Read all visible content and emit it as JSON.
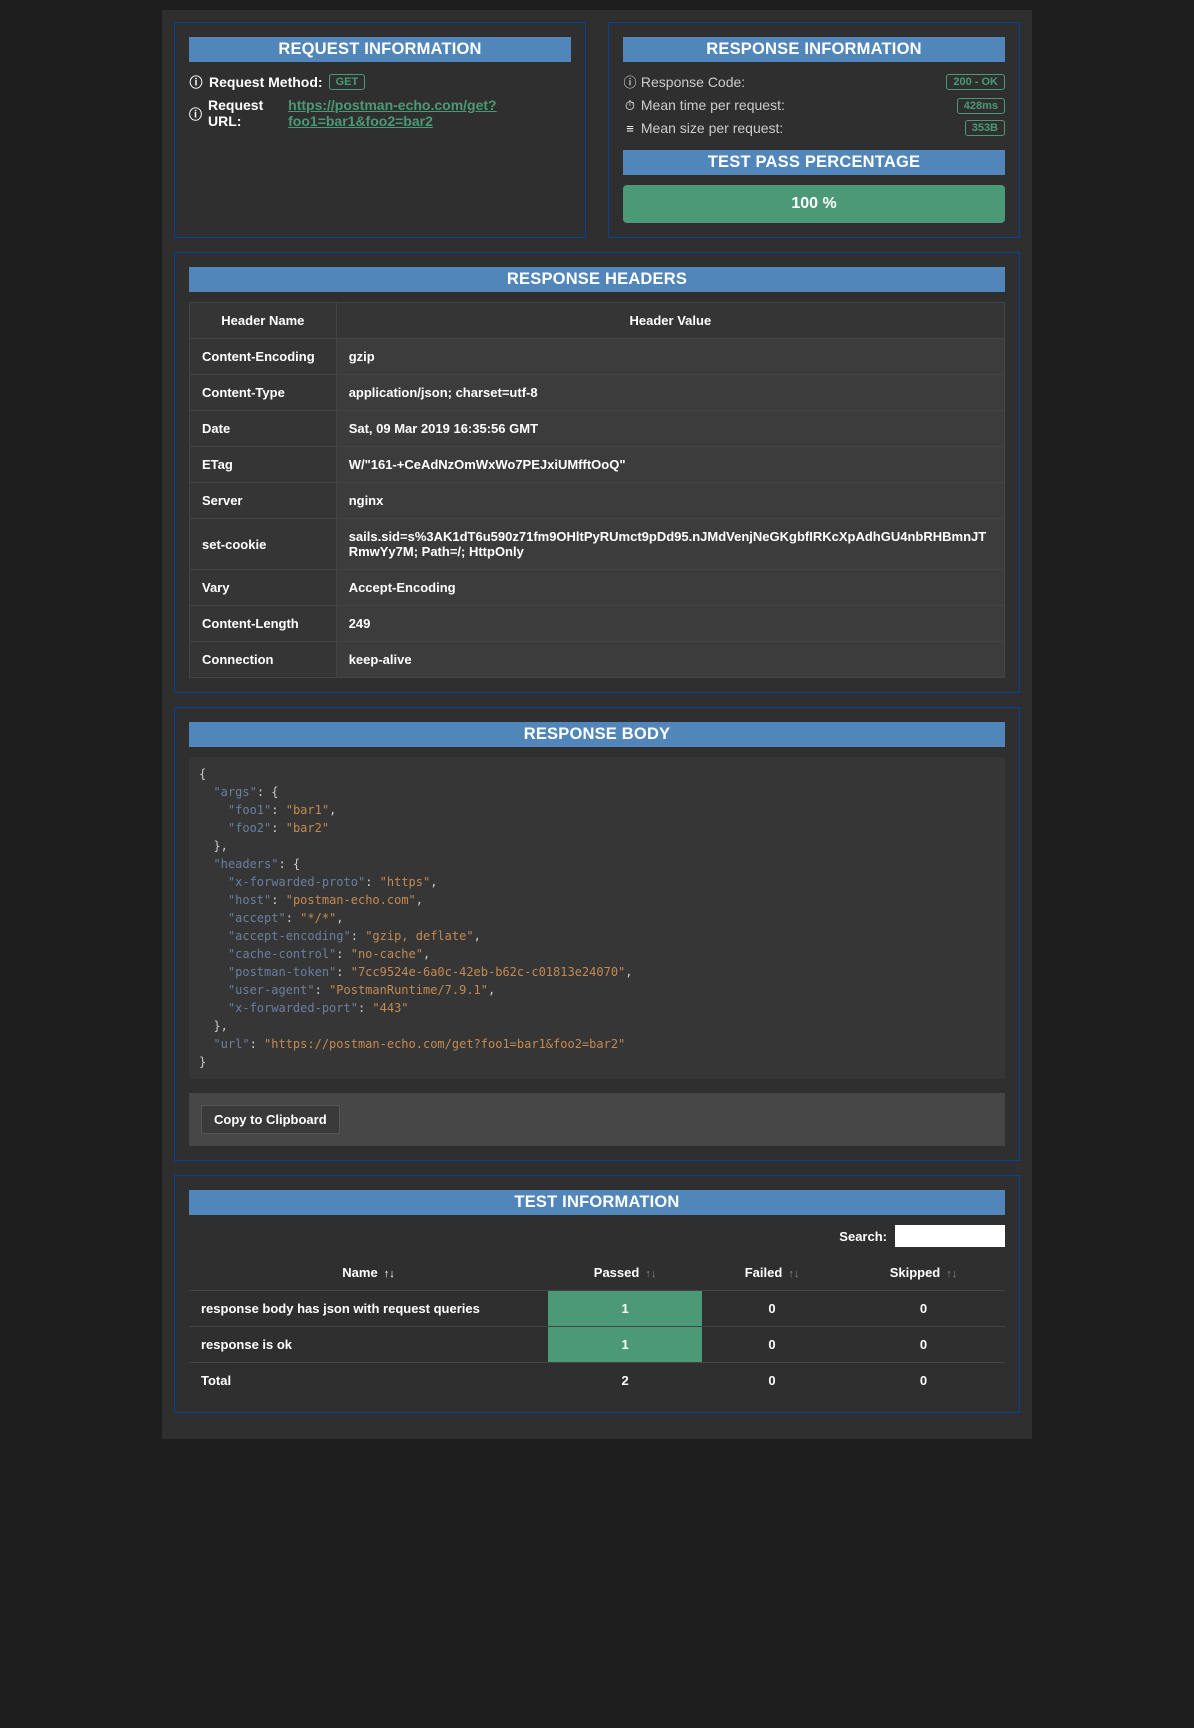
{
  "request_info": {
    "title": "REQUEST INFORMATION",
    "method_label": "Request Method:",
    "method_value": "GET",
    "url_label": "Request URL:",
    "url_value": "https://postman-echo.com/get?foo1=bar1&foo2=bar2"
  },
  "response_info": {
    "title": "RESPONSE INFORMATION",
    "code_label": "Response Code:",
    "code_value": "200 - OK",
    "time_label": "Mean time per request:",
    "time_value": "428ms",
    "size_label": "Mean size per request:",
    "size_value": "353B",
    "pass_title": "TEST PASS PERCENTAGE",
    "pass_value": "100 %"
  },
  "headers": {
    "title": "RESPONSE HEADERS",
    "col_name": "Header Name",
    "col_value": "Header Value",
    "rows": [
      {
        "name": "Content-Encoding",
        "value": "gzip"
      },
      {
        "name": "Content-Type",
        "value": "application/json; charset=utf-8"
      },
      {
        "name": "Date",
        "value": "Sat, 09 Mar 2019 16:35:56 GMT"
      },
      {
        "name": "ETag",
        "value": "W/\"161-+CeAdNzOmWxWo7PEJxiUMfftOoQ\""
      },
      {
        "name": "Server",
        "value": "nginx"
      },
      {
        "name": "set-cookie",
        "value": "sails.sid=s%3AK1dT6u590z71fm9OHltPyRUmct9pDd95.nJMdVenjNeGKgbfIRKcXpAdhGU4nbRHBmnJTRmwYy7M; Path=/; HttpOnly"
      },
      {
        "name": "Vary",
        "value": "Accept-Encoding"
      },
      {
        "name": "Content-Length",
        "value": "249"
      },
      {
        "name": "Connection",
        "value": "keep-alive"
      }
    ]
  },
  "body": {
    "title": "RESPONSE BODY",
    "copy_label": "Copy to Clipboard",
    "json": {
      "args": {
        "foo1": "bar1",
        "foo2": "bar2"
      },
      "headers": {
        "x-forwarded-proto": "https",
        "host": "postman-echo.com",
        "accept": "*/*",
        "accept-encoding": "gzip, deflate",
        "cache-control": "no-cache",
        "postman-token": "7cc9524e-6a0c-42eb-b62c-c01813e24070",
        "user-agent": "PostmanRuntime/7.9.1",
        "x-forwarded-port": "443"
      },
      "url": "https://postman-echo.com/get?foo1=bar1&foo2=bar2"
    }
  },
  "tests": {
    "title": "TEST INFORMATION",
    "search_label": "Search:",
    "col_name": "Name",
    "col_passed": "Passed",
    "col_failed": "Failed",
    "col_skipped": "Skipped",
    "rows": [
      {
        "name": "response body has json with request queries",
        "passed": 1,
        "failed": 0,
        "skipped": 0
      },
      {
        "name": "response is ok",
        "passed": 1,
        "failed": 0,
        "skipped": 0
      }
    ],
    "total_label": "Total",
    "total": {
      "passed": 2,
      "failed": 0,
      "skipped": 0
    }
  }
}
